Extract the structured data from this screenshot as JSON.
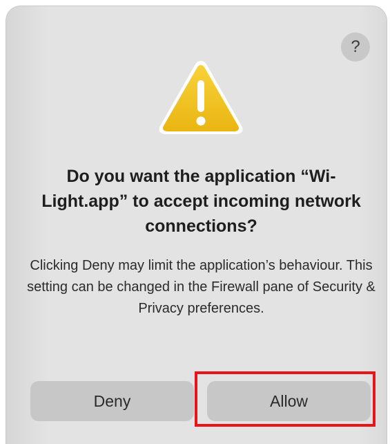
{
  "dialog": {
    "help_label": "?",
    "icon": "warning-icon",
    "title": "Do you want the application “Wi-Light.app” to accept incoming network connections?",
    "message": "Clicking Deny may limit the application’s behaviour. This setting can be changed in the Firewall pane of Security & Privacy preferences.",
    "deny_label": "Deny",
    "allow_label": "Allow"
  },
  "colors": {
    "warning_fill": "#f2c21b",
    "warning_border": "#ffffff",
    "highlight": "#e8141a",
    "dialog_bg": "#e3e3e3",
    "button_bg": "#c7c7c7"
  },
  "annotation": {
    "highlighted_element": "allow-button"
  }
}
